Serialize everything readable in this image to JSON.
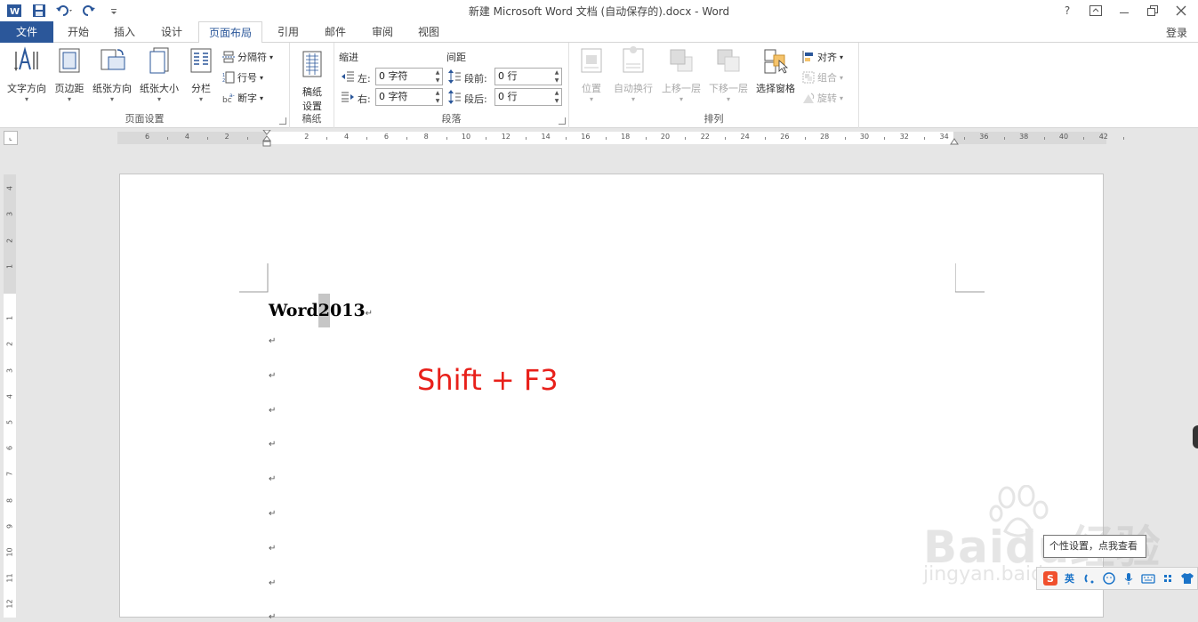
{
  "window": {
    "title": "新建 Microsoft Word 文档 (自动保存的).docx - Word",
    "help": "?",
    "controls": [
      "ribbon-display",
      "minimize",
      "restore",
      "close"
    ]
  },
  "tabs": {
    "file": "文件",
    "items": [
      "开始",
      "插入",
      "设计",
      "页面布局",
      "引用",
      "邮件",
      "审阅",
      "视图"
    ],
    "active": "页面布局",
    "login": "登录"
  },
  "ribbon": {
    "page_setup": {
      "label": "页面设置",
      "text_direction": "文字方向",
      "margins": "页边距",
      "orientation": "纸张方向",
      "size": "纸张大小",
      "columns": "分栏",
      "breaks": "分隔符",
      "line_numbers": "行号",
      "hyphenation": "断字"
    },
    "draft": {
      "label": "稿纸",
      "button_line1": "稿纸",
      "button_line2": "设置"
    },
    "paragraph": {
      "label": "段落",
      "indent_heading": "缩进",
      "spacing_heading": "间距",
      "left_label": "左:",
      "right_label": "右:",
      "before_label": "段前:",
      "after_label": "段后:",
      "left_value": "0 字符",
      "right_value": "0 字符",
      "before_value": "0 行",
      "after_value": "0 行"
    },
    "arrange": {
      "label": "排列",
      "position": "位置",
      "wrap_text": "自动换行",
      "bring_forward": "上移一层",
      "send_backward": "下移一层",
      "selection_pane": "选择窗格",
      "align": "对齐",
      "group": "组合",
      "rotate": "旋转"
    }
  },
  "ruler": {
    "horizontal_labels": [
      "6",
      "4",
      "2",
      "2",
      "4",
      "6",
      "8",
      "10",
      "12",
      "14",
      "16",
      "18",
      "20",
      "22",
      "24",
      "26",
      "28",
      "30",
      "32",
      "34",
      "36",
      "38",
      "40",
      "42"
    ],
    "vertical_labels": [
      "4",
      "3",
      "2",
      "1",
      "1",
      "2",
      "3",
      "4",
      "5",
      "6",
      "7",
      "8",
      "9",
      "10",
      "11",
      "12"
    ]
  },
  "document": {
    "first_line_before": "Word",
    "first_line_selected": "2",
    "first_line_after": "013",
    "paragraph_mark": "↵",
    "empty_paragraph_count": 9
  },
  "annotation": "Shift + F3",
  "tooltip": "个性设置，点我查看",
  "ime_toolbar": {
    "items": [
      "S",
      "英",
      "↶",
      "☺",
      "mic",
      "keyboard",
      "tools",
      "skin"
    ]
  },
  "watermark": {
    "logo": "Baidu经验",
    "url": "jingyan.baidu.com"
  },
  "colors": {
    "file_tab": "#2b579a",
    "annotation": "#e8201a",
    "selection": "#c6c6c6"
  }
}
